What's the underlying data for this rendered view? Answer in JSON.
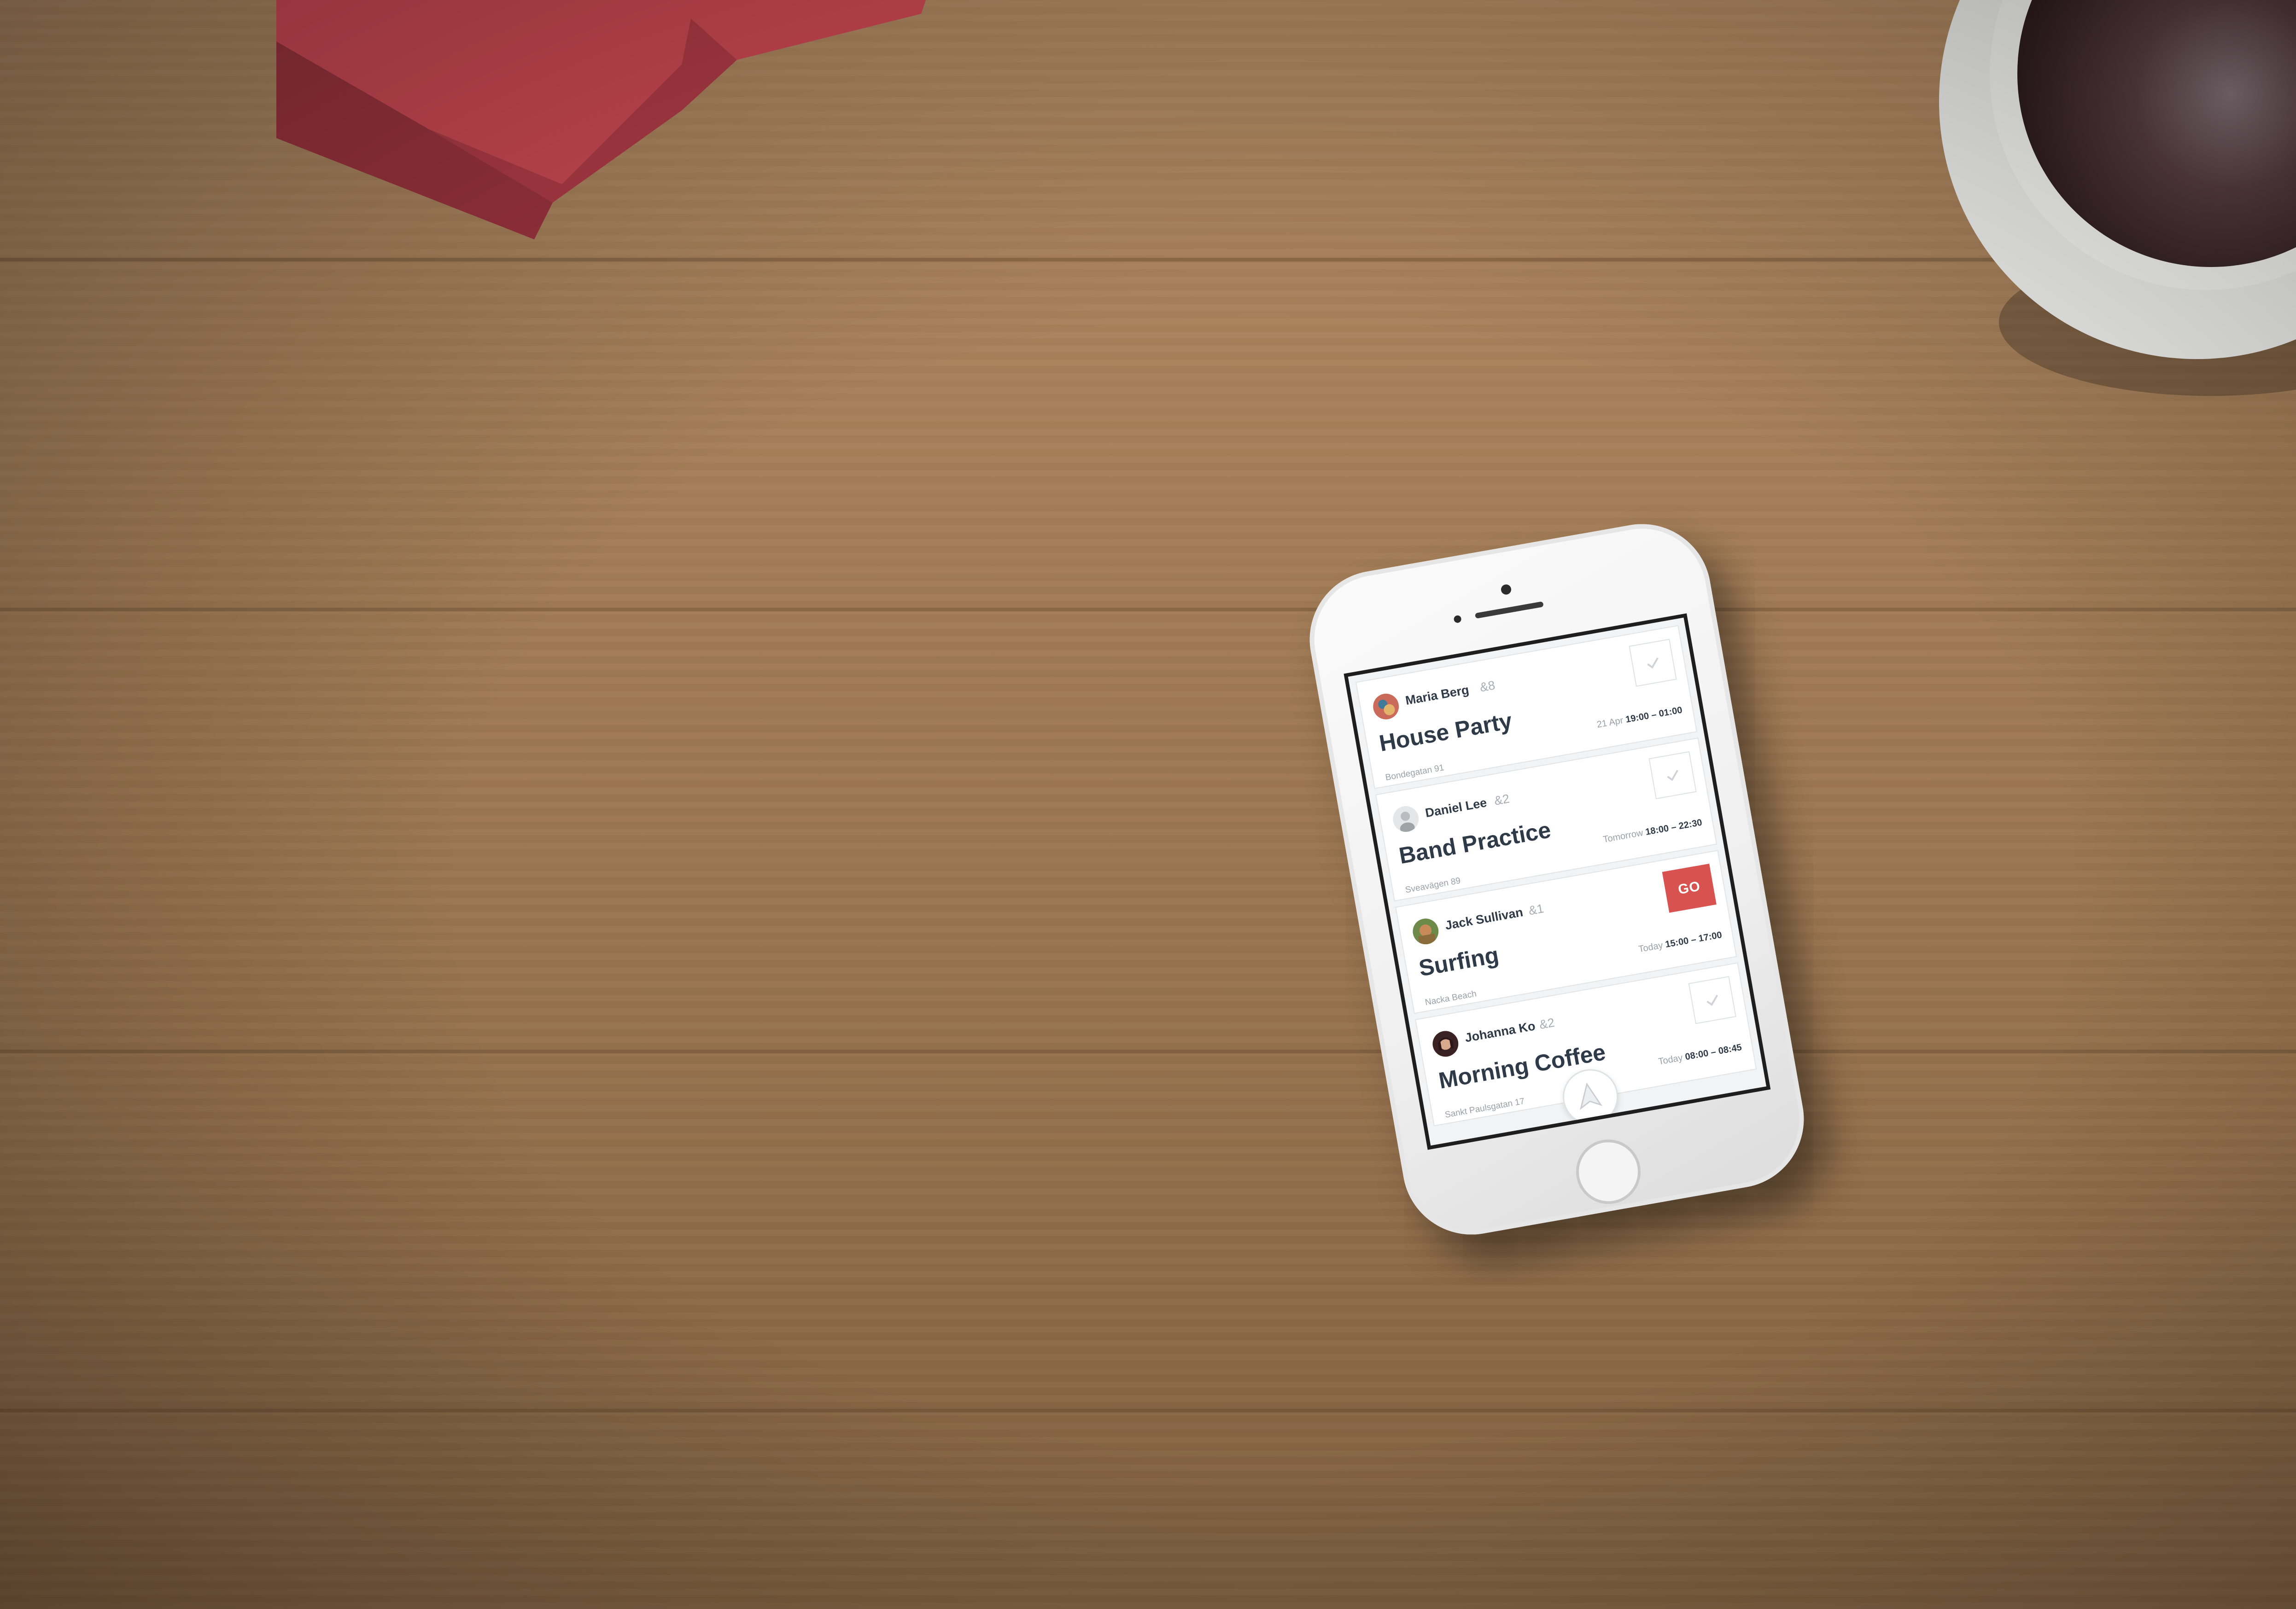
{
  "events": [
    {
      "host": "Maria Berg",
      "extra": "&8",
      "title": "House Party",
      "time_prefix": "21 Apr",
      "time_range": "19:00 – 01:00",
      "place": "Bondegatan 91",
      "action": "check",
      "avatar_color": "#c96a5a"
    },
    {
      "host": "Daniel Lee",
      "extra": "&2",
      "title": "Band Practice",
      "time_prefix": "Tomorrow",
      "time_range": "18:00 – 22:30",
      "place": "Sveavägen 89",
      "action": "check",
      "avatar_color": "#b9bdc1"
    },
    {
      "host": "Jack Sullivan",
      "extra": "&1",
      "title": "Surfing",
      "time_prefix": "Today",
      "time_range": "15:00 – 17:00",
      "place": "Nacka Beach",
      "action": "go",
      "go_label": "GO",
      "avatar_color": "#8a6b3a"
    },
    {
      "host": "Johanna Ko",
      "extra": "&2",
      "title": "Morning Coffee",
      "time_prefix": "Today",
      "time_range": "08:00 – 08:45",
      "place": "Sankt Paulsgatan 17",
      "action": "check",
      "avatar_color": "#6b3a3a"
    }
  ],
  "colors": {
    "go_button": "#d8534f",
    "text_dark": "#2e3a47",
    "text_muted": "#9aa1a8"
  },
  "icons": {
    "check": "check-icon",
    "fab": "navigation-arrow-icon"
  }
}
